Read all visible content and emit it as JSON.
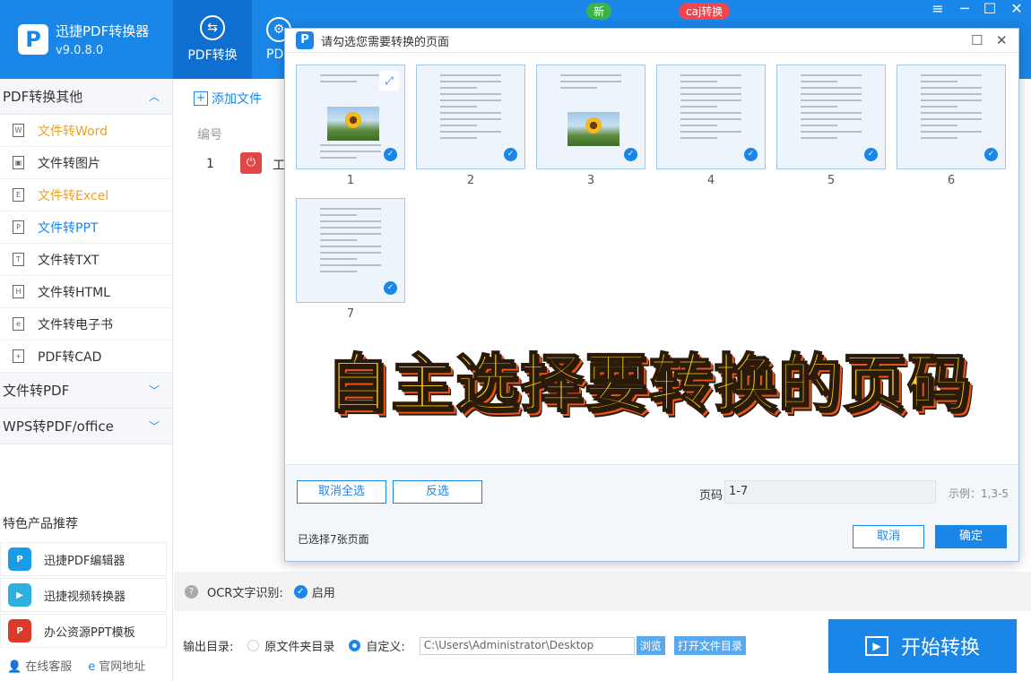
{
  "app": {
    "name": "迅捷PDF转换器",
    "version": "v9.0.8.0",
    "logo_glyph": "P"
  },
  "nav_tabs": [
    {
      "label": "PDF转换",
      "icon": "convert-icon",
      "active": true
    },
    {
      "label": "PD",
      "icon": "gear-icon",
      "active": false
    }
  ],
  "badges": {
    "new": "新",
    "caj": "caj转换"
  },
  "window_controls": {
    "menu": "≡",
    "minimize": "─",
    "maximize": "☐",
    "close": "✕"
  },
  "sidebar": {
    "group1_title": "PDF转换其他",
    "items": [
      {
        "label": "文件转Word",
        "icon": "W",
        "color": "orange"
      },
      {
        "label": "文件转图片",
        "icon": "▣",
        "color": "normal"
      },
      {
        "label": "文件转Excel",
        "icon": "E",
        "color": "orange"
      },
      {
        "label": "文件转PPT",
        "icon": "P",
        "color": "blue"
      },
      {
        "label": "文件转TXT",
        "icon": "T",
        "color": "normal"
      },
      {
        "label": "文件转HTML",
        "icon": "H",
        "color": "normal"
      },
      {
        "label": "文件转电子书",
        "icon": "e",
        "color": "normal"
      },
      {
        "label": "PDF转CAD",
        "icon": "+",
        "color": "normal"
      }
    ],
    "group2_title": "文件转PDF",
    "group3_title": "WPS转PDF/office",
    "featured_title": "特色产品推荐",
    "featured": [
      {
        "label": "迅捷PDF编辑器",
        "color": "#1a9be8"
      },
      {
        "label": "迅捷视频转换器",
        "color": "#2bb0e0"
      },
      {
        "label": "办公资源PPT模板",
        "color": "#d93a2a"
      }
    ],
    "bottom_links": [
      "在线客服",
      "官网地址"
    ]
  },
  "main": {
    "add_file": "添加文件",
    "col_number": "编号",
    "row_index": "1",
    "row_name": "工",
    "ocr_label": "OCR文字识别:",
    "ocr_enable": "启用",
    "output_label": "输出目录:",
    "option_source": "原文件夹目录",
    "option_custom": "自定义:",
    "path_value": "C:\\Users\\Administrator\\Desktop",
    "browse": "浏览",
    "open_folder": "打开文件目录",
    "start": "开始转换"
  },
  "dialog": {
    "title": "请勾选您需要转换的页面",
    "pages": [
      "1",
      "2",
      "3",
      "4",
      "5",
      "6",
      "7"
    ],
    "banner": "自主选择要转换的页码",
    "btn_deselect_all": "取消全选",
    "btn_invert": "反选",
    "page_label": "页码",
    "page_value": "1-7",
    "example": "示例：1,3-5",
    "selected_text": "已选择7张页面",
    "btn_cancel": "取消",
    "btn_ok": "确定"
  }
}
